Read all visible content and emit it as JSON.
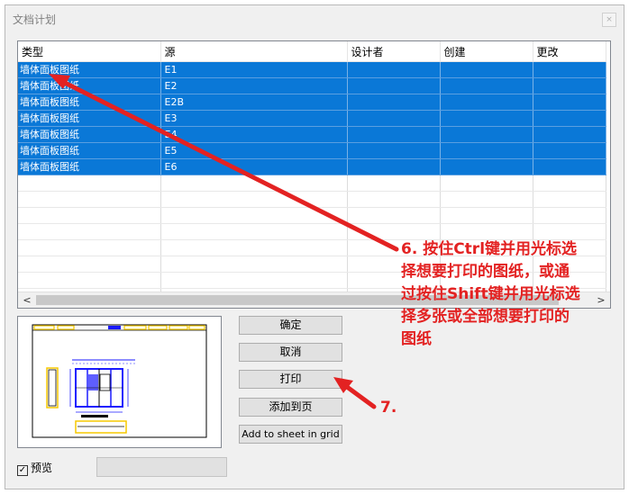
{
  "window": {
    "title": "文档计划",
    "close_glyph": "×"
  },
  "grid": {
    "columns": [
      "类型",
      "源",
      "设计者",
      "创建",
      "更改"
    ],
    "rows": [
      {
        "type": "墙体面板图纸",
        "source": "E1"
      },
      {
        "type": "墙体面板图纸",
        "source": "E2"
      },
      {
        "type": "墙体面板图纸",
        "source": "E2B"
      },
      {
        "type": "墙体面板图纸",
        "source": "E3"
      },
      {
        "type": "墙体面板图纸",
        "source": "E4"
      },
      {
        "type": "墙体面板图纸",
        "source": "E5"
      },
      {
        "type": "墙体面板图纸",
        "source": "E6"
      }
    ],
    "scroll_left_glyph": "<",
    "scroll_right_glyph": ">"
  },
  "buttons": {
    "ok": "确定",
    "cancel": "取消",
    "print": "打印",
    "add_to_page": "添加到页",
    "add_to_sheet": "Add to sheet in grid"
  },
  "preview_checkbox": {
    "label": "预览",
    "checked": true,
    "check_glyph": "✓"
  },
  "annotations": {
    "step6_lines": [
      "6. 按住Ctrl键并用光标选",
      "择想要打印的图纸，或通",
      "过按住Shift键并用光标选",
      "择多张或全部想要打印的",
      "图纸"
    ],
    "step7": "7."
  },
  "colors": {
    "selection": "#0a78d7",
    "annotation": "#e32222",
    "drawing_blue": "#1a1aff",
    "drawing_yellow": "#f5c800"
  }
}
